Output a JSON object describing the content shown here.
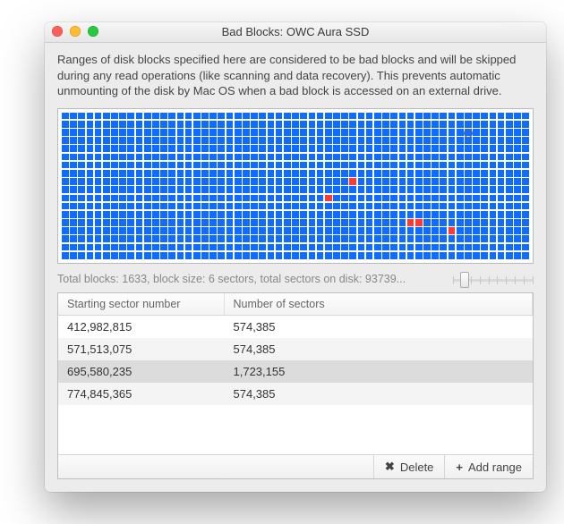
{
  "window": {
    "title": "Bad Blocks: OWC Aura SSD"
  },
  "description": "Ranges of disk blocks specified here are considered to be bad blocks and will be skipped during any read operations (like scanning and data recovery). This prevents automatic unmounting of the disk by Mac OS when a bad block is accessed on an external drive.",
  "grid": {
    "cols": 57,
    "rows": 18,
    "bad_cells": [
      [
        8,
        35
      ],
      [
        10,
        32
      ],
      [
        13,
        42
      ],
      [
        13,
        43
      ],
      [
        14,
        47
      ]
    ],
    "cursor": {
      "row": 2,
      "col": 49
    }
  },
  "summary": "Total blocks: 1633, block size: 6 sectors, total sectors on disk: 93739...",
  "slider": {
    "position_pct": 14,
    "ticks": 10
  },
  "table": {
    "columns": {
      "start": "Starting sector number",
      "count": "Number of sectors"
    },
    "rows": [
      {
        "start": "412,982,815",
        "count": "574,385"
      },
      {
        "start": "571,513,075",
        "count": "574,385"
      },
      {
        "start": "695,580,235",
        "count": "1,723,155"
      },
      {
        "start": "774,845,365",
        "count": "574,385"
      }
    ],
    "selected_index": 2
  },
  "buttons": {
    "delete": "Delete",
    "add_range": "Add range"
  },
  "icons": {
    "delete": "✖",
    "add": "+"
  }
}
